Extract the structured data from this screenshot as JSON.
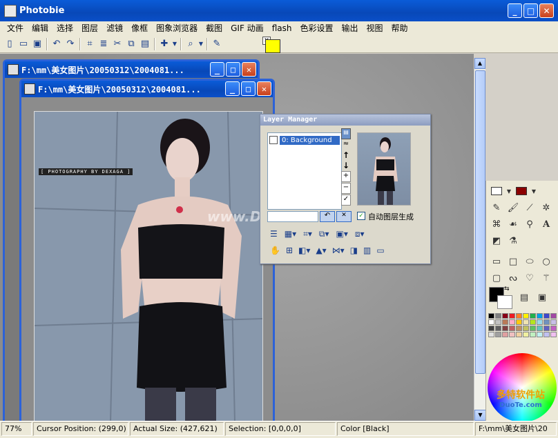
{
  "app": {
    "title": "Photobie"
  },
  "menu": [
    "文件",
    "编辑",
    "选择",
    "图层",
    "滤镜",
    "像框",
    "图象浏览器",
    "截图",
    "GIF 动画",
    "flash",
    "色彩设置",
    "输出",
    "视图",
    "帮助"
  ],
  "toolbar_icons": [
    "new-icon",
    "open-icon",
    "save-icon",
    "undo-icon",
    "redo-icon",
    "crop-icon",
    "text-icon",
    "cut-icon",
    "copy-icon",
    "paste-icon",
    "add-icon",
    "zoom-icon",
    "edit-icon"
  ],
  "doc_back": {
    "title": "F:\\mm\\美女图片\\20050312\\2004081..."
  },
  "doc_front": {
    "title": "F:\\mm\\美女图片\\20050312\\2004081..."
  },
  "photo": {
    "credit": "[ PHOTOGRAPHY BY DEXAGA ]",
    "watermark": "www.DuoTe.com"
  },
  "layer_manager": {
    "title": "Layer Manager",
    "layers": [
      "0: Background"
    ],
    "auto_layer_label": "自动图层生成",
    "auto_layer_checked": true
  },
  "colors": {
    "foreground": "#000000",
    "background": "#ffffff",
    "primary_swatch": "#8b0000",
    "palette": [
      "#000000",
      "#7f7f7f",
      "#880015",
      "#ed1c24",
      "#ff7f27",
      "#fff200",
      "#22b14c",
      "#00a2e8",
      "#3f48cc",
      "#a349a4",
      "#ffffff",
      "#c3c3c3",
      "#b97a57",
      "#ffaec9",
      "#ffc90e",
      "#efe4b0",
      "#b5e61d",
      "#99d9ea",
      "#7092be",
      "#c8bfe7",
      "#404040",
      "#606060",
      "#804040",
      "#c06060",
      "#c09060",
      "#c0c060",
      "#60c060",
      "#60c0c0",
      "#6060c0",
      "#c060c0",
      "#e0e0e0",
      "#a0a0a0",
      "#e0a0a0",
      "#f0c0c0",
      "#f0d0a0",
      "#f0f0a0",
      "#c0f0c0",
      "#c0f0f0",
      "#c0c0f0",
      "#f0c0f0"
    ]
  },
  "status": {
    "zoom": "77%",
    "cursor": "Cursor Position: (299,0)",
    "actual_size": "Actual Size: (427,621)",
    "selection": "Selection: [0,0,0,0]",
    "color": "Color [Black]",
    "path": "F:\\mm\\美女图片\\20"
  },
  "watermark_brand": {
    "cn": "多特软件站",
    "en": "DuoTe.com"
  }
}
